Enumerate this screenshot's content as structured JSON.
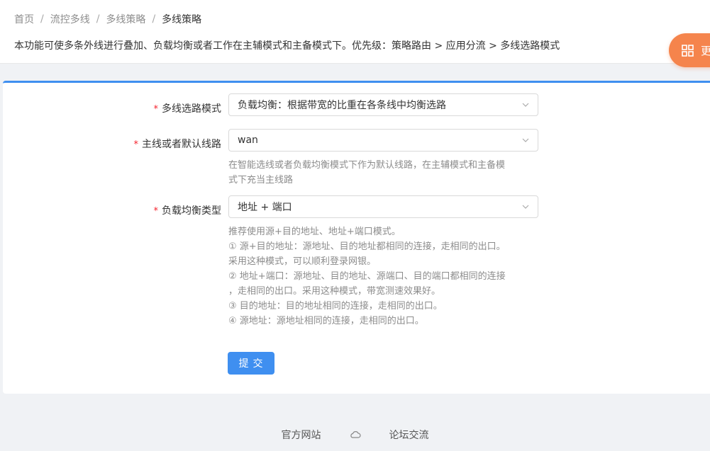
{
  "breadcrumb": {
    "items": [
      "首页",
      "流控多线",
      "多线策略"
    ],
    "current": "多线策略",
    "separator": "/"
  },
  "description": "本功能可使多条外线进行叠加、负载均衡或者工作在主辅模式和主备模式下。优先级：策略路由 > 应用分流 > 多线选路模式",
  "float_button": {
    "label": "更",
    "icon": "grid-icon"
  },
  "form": {
    "fields": [
      {
        "label": "多线选路模式",
        "required": true,
        "value": "负载均衡：根据带宽的比重在各条线中均衡选路"
      },
      {
        "label": "主线或者默认线路",
        "required": true,
        "value": "wan",
        "help": [
          "在智能选线或者负载均衡模式下作为默认线路，在主辅模式和主备模",
          "式下充当主线路"
        ]
      },
      {
        "label": "负载均衡类型",
        "required": true,
        "value": "地址 + 端口",
        "help": [
          "推荐使用源+目的地址、地址+端口模式。",
          "① 源+目的地址：源地址、目的地址都相同的连接，走相同的出口。",
          "采用这种模式，可以顺利登录网银。",
          "② 地址+端口：源地址、目的地址、源端口、目的端口都相同的连接",
          "，走相同的出口。采用这种模式，带宽测速效果好。",
          "③ 目的地址：目的地址相同的连接，走相同的出口。",
          "④ 源地址：源地址相同的连接，走相同的出口。"
        ]
      }
    ],
    "required_mark": "*",
    "submit_label": "提交"
  },
  "footer": {
    "links": [
      "官方网站",
      "论坛交流"
    ],
    "icon": "cloud-icon"
  },
  "colors": {
    "accent": "#3f8ff0",
    "float": "#f5844c",
    "required": "#f5222d"
  }
}
